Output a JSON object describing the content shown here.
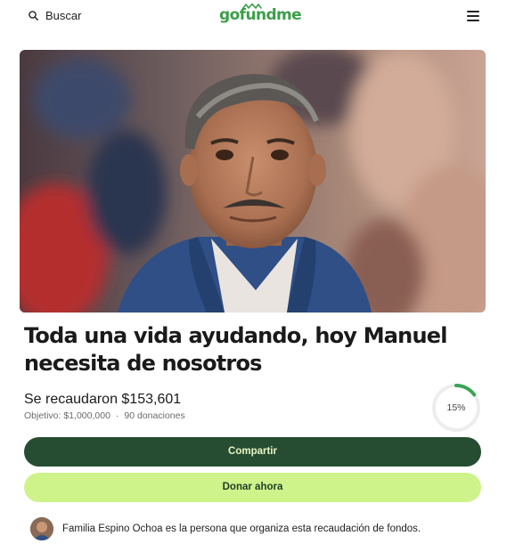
{
  "header": {
    "search_label": "Buscar",
    "logo_text": "gofundme",
    "search_icon": "search-icon",
    "menu_icon": "hamburger-menu-icon"
  },
  "hero": {
    "image": "portrait-photo"
  },
  "campaign": {
    "title": "Toda una vida ayudando, hoy Manuel necesita de nosotros",
    "raised_text": "Se recaudaron $153,601",
    "goal_text": "Objetivo: $1,000,000",
    "separator": "·",
    "donations_text": "90 donaciones",
    "progress_label": "15%",
    "progress_fraction": 0.15
  },
  "actions": {
    "share_label": "Compartir",
    "donate_label": "Donar ahora"
  },
  "organizer": {
    "text": "Familia Espino Ochoa es la persona que organiza esta recaudación de fondos."
  },
  "colors": {
    "brand_green": "#3c9e4a",
    "share_bg": "#264d32",
    "donate_bg": "#cef38a",
    "progress_fill": "#3aa655",
    "progress_track": "#ededed"
  }
}
